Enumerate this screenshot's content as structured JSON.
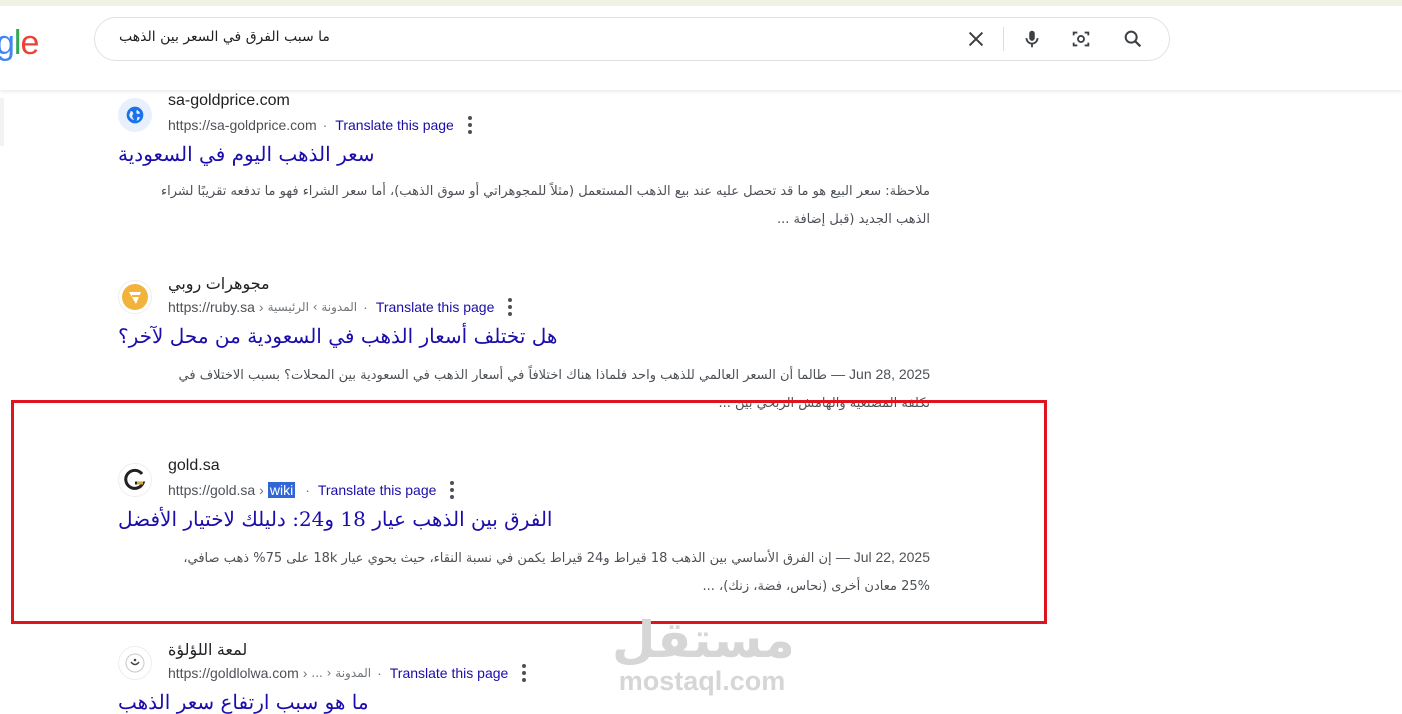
{
  "search": {
    "logo_partial": "gle",
    "query": "ما سبب الفرق في السعر بين الذهب"
  },
  "results": [
    {
      "site_name": "sa-goldprice.com",
      "url": "https://sa-goldprice.com",
      "breadcrumb": "",
      "translate_label": "Translate this page",
      "title": "سعر الذهب اليوم في السعودية",
      "snippet_line1": "ملاحظة: سعر البيع هو ما قد تحصل عليه عند بيع الذهب المستعمل (مثلاً للمجوهراتي أو سوق الذهب)، أما سعر الشراء فهو ما تدفعه تقريبًا لشراء",
      "snippet_line2": "الذهب الجديد (قبل إضافة ..."
    },
    {
      "site_name": "مجوهرات روبي",
      "url": "https://ruby.sa",
      "breadcrumb": "المدونة › الرئيسية",
      "translate_label": "Translate this page",
      "title": "هل تختلف أسعار الذهب في السعودية من محل لآخر؟",
      "date": "Jun 28, 2025 —",
      "snippet_line1": "طالما أن السعر العالمي للذهب واحد فلماذا هناك اختلافاً في أسعار الذهب في السعودية بين المحلات؟ بسبب الاختلاف في",
      "snippet_line2": "تكلفة المصنعية والهامش الربحي بين ..."
    },
    {
      "site_name": "gold.sa",
      "url": "https://gold.sa",
      "breadcrumb": "wiki",
      "translate_label": "Translate this page",
      "title": "الفرق بين الذهب عيار 18 و24: دليلك لاختيار الأفضل",
      "date": "Jul 22, 2025 —",
      "snippet_line1": "إن الفرق الأساسي بين الذهب 18 قيراط و24 قيراط يكمن في نسبة النقاء، حيث يحوي عيار 18k على 75% ذهب صافي،",
      "snippet_line2": "25% معادن أخرى (نحاس، فضة، زنك)، ..."
    },
    {
      "site_name": "لمعة اللؤلؤة",
      "url": "https://goldlolwa.com",
      "breadcrumb": "... › المدونة",
      "translate_label": "Translate this page",
      "title": "ما هو سبب ارتفاع سعر الذهب"
    }
  ],
  "watermark": {
    "arabic": "مستقل",
    "latin": "mostaql.com"
  }
}
